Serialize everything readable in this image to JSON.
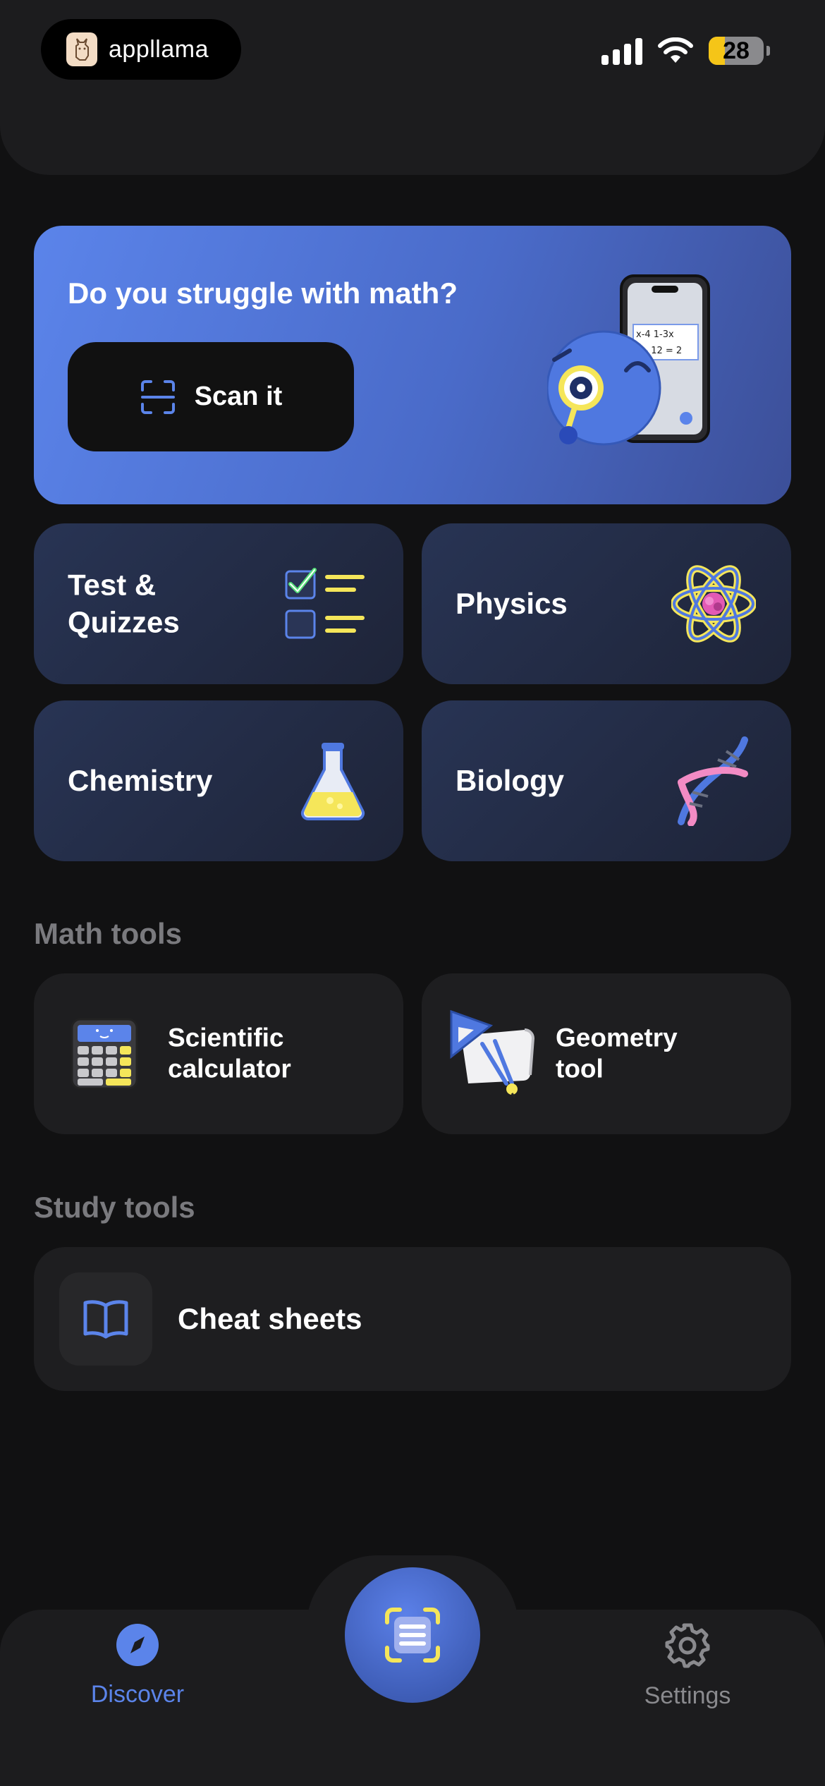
{
  "brand": {
    "name": "appllama"
  },
  "status_bar": {
    "battery": "28"
  },
  "banner": {
    "title": "Do you struggle with math?",
    "button_label": "Scan it"
  },
  "subjects": [
    {
      "label": "Test & Quizzes",
      "icon": "checklist-icon"
    },
    {
      "label": "Physics",
      "icon": "atom-icon"
    },
    {
      "label": "Chemistry",
      "icon": "flask-icon"
    },
    {
      "label": "Biology",
      "icon": "dna-icon"
    }
  ],
  "math_tools": {
    "title": "Math tools",
    "items": [
      {
        "label": "Scientific calculator",
        "icon": "calculator-icon"
      },
      {
        "label": "Geometry tool",
        "icon": "geometry-icon"
      }
    ]
  },
  "study_tools": {
    "title": "Study tools",
    "items": [
      {
        "label": "Cheat sheets",
        "icon": "book-icon"
      }
    ]
  },
  "tab_bar": {
    "discover": "Discover",
    "settings": "Settings",
    "center_icon": "scan-document-icon"
  },
  "colors": {
    "accent": "#5b84ea",
    "yellow": "#f5e65a",
    "background": "#111112",
    "card": "#1e1e20"
  }
}
